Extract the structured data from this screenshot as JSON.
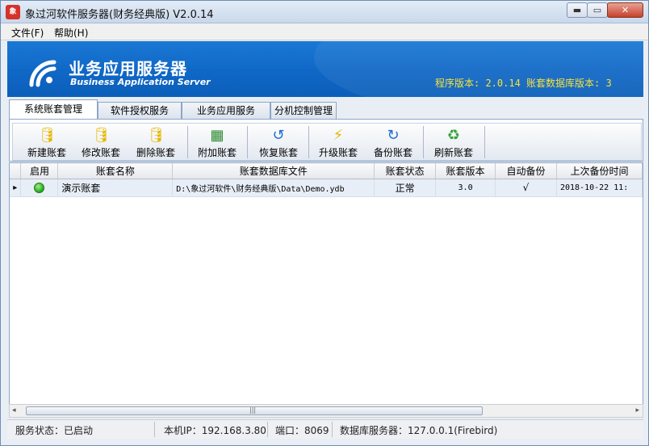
{
  "window": {
    "title": "象过河软件服务器(财务经典版) V2.0.14",
    "icon_text": "象",
    "min_glyph": "▬",
    "max_glyph": "▭",
    "close_glyph": "✕"
  },
  "menu": [
    {
      "label": "文件(F)"
    },
    {
      "label": "帮助(H)"
    }
  ],
  "banner": {
    "title": "业务应用服务器",
    "subtitle": "Business Application Server",
    "version_text": "程序版本: 2.0.14  账套数据库版本: 3",
    "accent_color": "#f7e23b"
  },
  "tabs": [
    {
      "label": "系统账套管理",
      "active": true
    },
    {
      "label": "软件授权服务",
      "active": false
    },
    {
      "label": "业务应用服务",
      "active": false
    },
    {
      "label": "分机控制管理",
      "active": false
    }
  ],
  "toolbar": [
    {
      "label": "新建账套",
      "icon": "database-add-icon",
      "glyph": "🛢",
      "color": "#e6b800"
    },
    {
      "label": "修改账套",
      "icon": "database-edit-icon",
      "glyph": "🛢",
      "color": "#e6b800"
    },
    {
      "label": "删除账套",
      "icon": "database-delete-icon",
      "glyph": "🛢",
      "color": "#e6b800"
    },
    {
      "label": "附加账套",
      "icon": "table-grid-icon",
      "glyph": "▦",
      "color": "#2c8a2c"
    },
    {
      "label": "恢复账套",
      "icon": "restore-icon",
      "glyph": "↺",
      "color": "#1f6fd0"
    },
    {
      "label": "升级账套",
      "icon": "upgrade-icon",
      "glyph": "⚡",
      "color": "#e6b800"
    },
    {
      "label": "备份账套",
      "icon": "backup-icon",
      "glyph": "↻",
      "color": "#1f6fd0"
    },
    {
      "label": "刷新账套",
      "icon": "refresh-icon",
      "glyph": "♻",
      "color": "#3aa33a"
    }
  ],
  "grid": {
    "columns": [
      "",
      "启用",
      "账套名称",
      "账套数据库文件",
      "账套状态",
      "账套版本",
      "自动备份",
      "上次备份时间"
    ],
    "rows": [
      {
        "pointer": "▸",
        "enabled_icon": "green-status-dot-icon",
        "name": "演示账套",
        "file": "D:\\象过河软件\\财务经典版\\Data\\Demo.ydb",
        "status": "正常",
        "version": "3.0",
        "auto_backup": "√",
        "last_backup": "2018-10-22 11:"
      }
    ]
  },
  "scrollbar": {
    "left_glyph": "◂",
    "right_glyph": "▸",
    "grip": "|||"
  },
  "status": {
    "service": "服务状态：已启动",
    "ip": "本机IP：192.168.3.80",
    "port": "端口：8069",
    "db": "数据库服务器：127.0.0.1(Firebird)"
  }
}
